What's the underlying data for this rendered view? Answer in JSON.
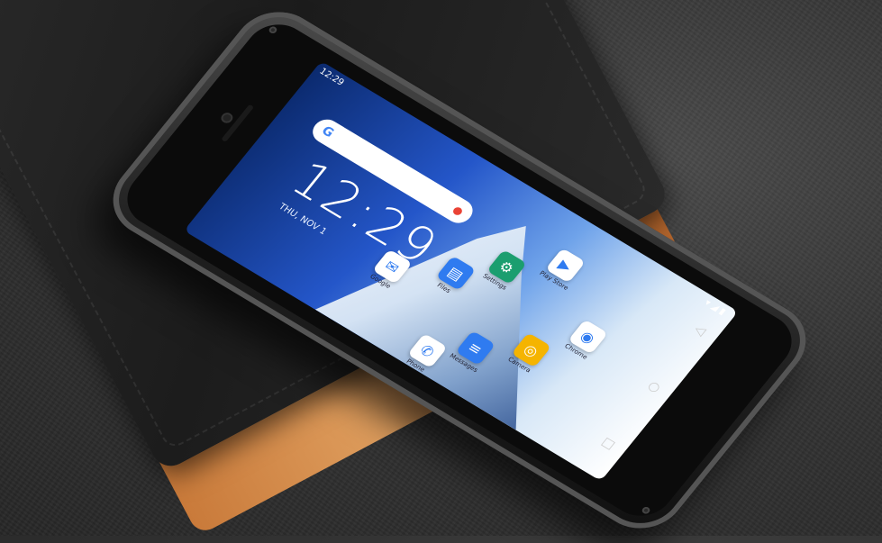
{
  "status_bar": {
    "time": "12:29"
  },
  "lock": {
    "clock": "12:29",
    "date": "THU, NOV 1"
  },
  "search": {
    "logo": "G",
    "mic_icon": "mic-icon"
  },
  "apps": [
    {
      "label": "Play Store",
      "icon": "play-store-icon",
      "color": "#ffffff",
      "glyph": "▶"
    },
    {
      "label": "Settings",
      "icon": "settings-icon",
      "color": "#1b9e6f",
      "glyph": "⚙"
    },
    {
      "label": "Files",
      "icon": "files-icon",
      "color": "#2f7bf0",
      "glyph": "▤"
    },
    {
      "label": "Chrome",
      "icon": "chrome-icon",
      "color": "#ffffff",
      "glyph": "◉"
    },
    {
      "label": "Google",
      "icon": "google-folder-icon",
      "color": "#ffffff",
      "glyph": "✉"
    },
    {
      "label": "Camera",
      "icon": "camera-icon",
      "color": "#f5b400",
      "glyph": "◎"
    },
    {
      "label": "Messages",
      "icon": "messages-icon",
      "color": "#2f7bf0",
      "glyph": "≡"
    },
    {
      "label": "Phone",
      "icon": "phone-icon",
      "color": "#ffffff",
      "glyph": "✆"
    }
  ],
  "navigation": {
    "back": "◁",
    "home": "○",
    "recents": "□"
  }
}
